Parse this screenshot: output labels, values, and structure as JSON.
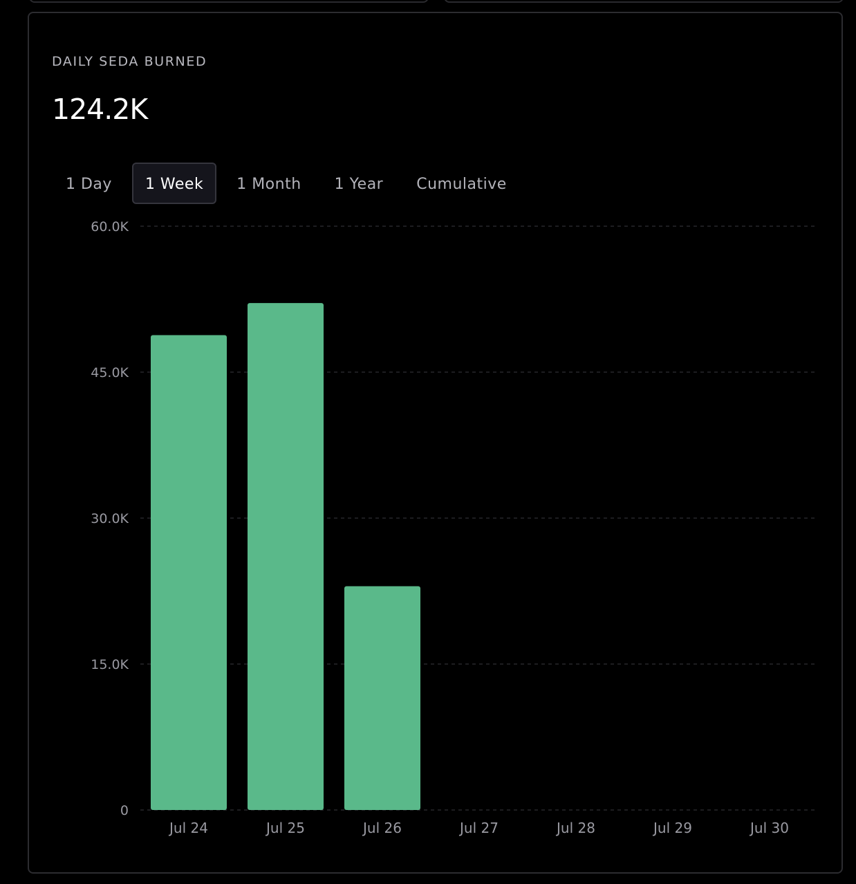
{
  "card": {
    "title": "DAILY SEDA BURNED",
    "value": "124.2K"
  },
  "tabs": [
    {
      "label": "1 Day",
      "active": false
    },
    {
      "label": "1 Week",
      "active": true
    },
    {
      "label": "1 Month",
      "active": false
    },
    {
      "label": "1 Year",
      "active": false
    },
    {
      "label": "Cumulative",
      "active": false
    }
  ],
  "colors": {
    "bar": "#5ab98a",
    "grid": "#3a3a40",
    "tick_label": "#9a9aa2",
    "background": "#000000"
  },
  "chart_data": {
    "type": "bar",
    "categories": [
      "Jul 24",
      "Jul 25",
      "Jul 26",
      "Jul 27",
      "Jul 28",
      "Jul 29",
      "Jul 30"
    ],
    "values": [
      48800,
      52100,
      23000,
      0,
      0,
      0,
      0
    ],
    "ylim": [
      0,
      60000
    ],
    "yticks": [
      0,
      15000,
      30000,
      45000,
      60000
    ],
    "ytick_labels": [
      "0",
      "15.0K",
      "30.0K",
      "45.0K",
      "60.0K"
    ],
    "grid": true,
    "grid_style": "dashed"
  }
}
